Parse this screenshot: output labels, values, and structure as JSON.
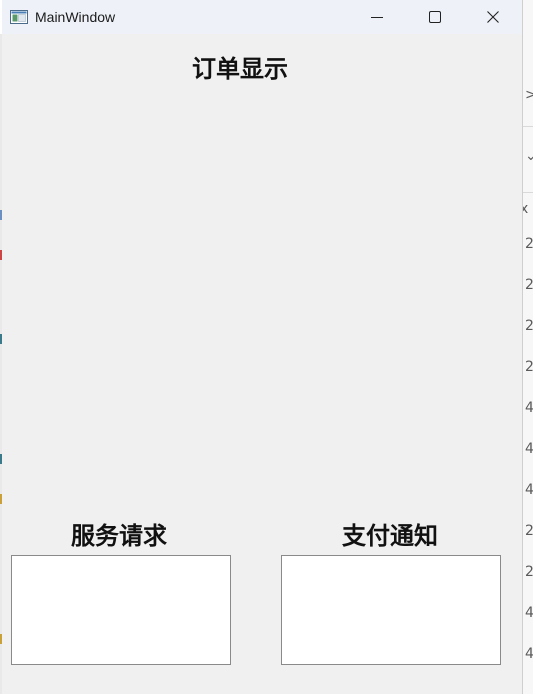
{
  "window": {
    "title": "MainWindow",
    "icon": "app-window-icon",
    "controls": [
      "minimize-icon",
      "maximize-icon",
      "close-icon"
    ]
  },
  "main": {
    "orders_heading": "订单显示",
    "service_heading": "服务请求",
    "payment_heading": "支付通知",
    "service_text": "",
    "payment_text": ""
  },
  "background_app": {
    "glyphs": [
      ">",
      "⌄",
      "x",
      "2",
      "2",
      "2",
      "2",
      "4",
      "4",
      "4",
      "2",
      "2",
      "4",
      "4"
    ]
  }
}
